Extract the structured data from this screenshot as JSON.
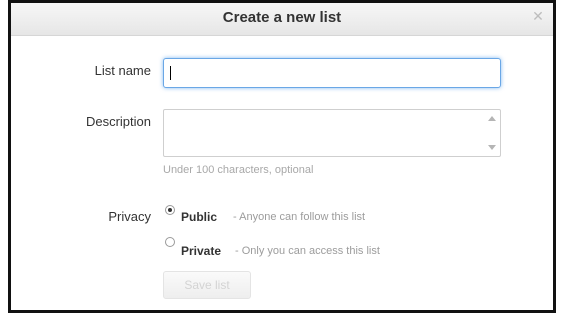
{
  "dialog": {
    "title": "Create a new list",
    "close_icon": "close-icon"
  },
  "form": {
    "list_name": {
      "label": "List name",
      "value": ""
    },
    "description": {
      "label": "Description",
      "value": "",
      "hint": "Under 100 characters, optional"
    },
    "privacy": {
      "label": "Privacy",
      "options": [
        {
          "label": "Public",
          "description": "Anyone can follow this list",
          "selected": true
        },
        {
          "label": "Private",
          "description": "Only you can access this list",
          "selected": false
        }
      ]
    },
    "save_button": {
      "label": "Save list",
      "disabled": true
    }
  }
}
